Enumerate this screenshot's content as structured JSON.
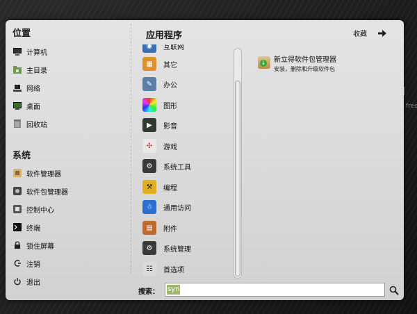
{
  "places": {
    "title": "位置",
    "items": [
      {
        "label": "计算机",
        "icon": "computer-icon"
      },
      {
        "label": "主目录",
        "icon": "home-folder-icon"
      },
      {
        "label": "网络",
        "icon": "network-icon"
      },
      {
        "label": "桌面",
        "icon": "desktop-icon"
      },
      {
        "label": "回收站",
        "icon": "trash-icon"
      }
    ]
  },
  "system": {
    "title": "系统",
    "items": [
      {
        "label": "软件管理器",
        "icon": "software-manager-icon"
      },
      {
        "label": "软件包管理器",
        "icon": "package-manager-icon"
      },
      {
        "label": "控制中心",
        "icon": "control-center-icon"
      },
      {
        "label": "终端",
        "icon": "terminal-icon"
      },
      {
        "label": "锁住屏幕",
        "icon": "lock-icon"
      },
      {
        "label": "注销",
        "icon": "logout-icon"
      },
      {
        "label": "退出",
        "icon": "power-icon"
      }
    ]
  },
  "apps": {
    "title": "应用程序",
    "favorites_label": "收藏",
    "categories": [
      {
        "label": "互联网",
        "icon": "internet-icon",
        "color": "#3b6fb5"
      },
      {
        "label": "其它",
        "icon": "other-icon",
        "color": "#e0902a"
      },
      {
        "label": "办公",
        "icon": "office-icon",
        "color": "#5a7fa8"
      },
      {
        "label": "图形",
        "icon": "graphics-icon",
        "color": "#c44fb0"
      },
      {
        "label": "影音",
        "icon": "multimedia-icon",
        "color": "#2e3a2e"
      },
      {
        "label": "游戏",
        "icon": "games-icon",
        "color": "#e8e8e8"
      },
      {
        "label": "系统工具",
        "icon": "system-tools-icon",
        "color": "#3a3a3a"
      },
      {
        "label": "编程",
        "icon": "programming-icon",
        "color": "#e0b020"
      },
      {
        "label": "通用访问",
        "icon": "accessibility-icon",
        "color": "#2a6fd1"
      },
      {
        "label": "附件",
        "icon": "accessories-icon",
        "color": "#c06a2a"
      },
      {
        "label": "系统管理",
        "icon": "administration-icon",
        "color": "#3a3a3a"
      },
      {
        "label": "首选项",
        "icon": "preferences-icon",
        "color": "#dadada"
      }
    ],
    "results": [
      {
        "name": "新立得软件包管理器",
        "description": "安装，删除和升级软件包"
      }
    ]
  },
  "search": {
    "label": "搜索：",
    "value": "syn"
  },
  "watermark": {
    "text": "nu",
    "sub": "free"
  }
}
